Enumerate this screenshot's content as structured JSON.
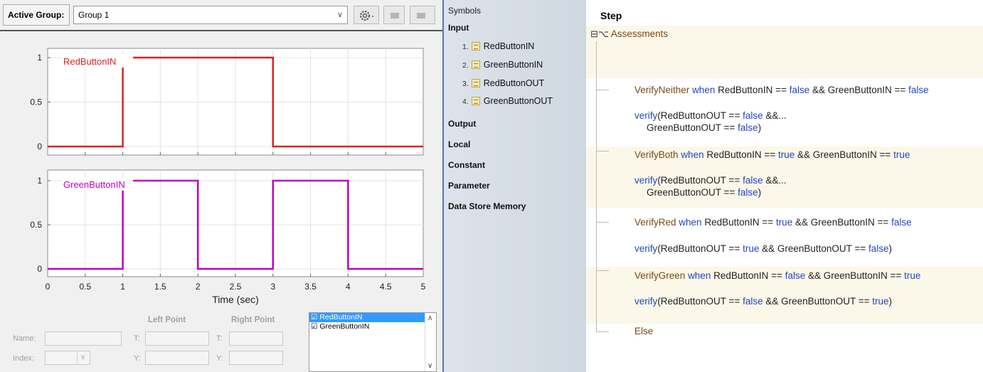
{
  "toolbar": {
    "active_group_label": "Active Group:",
    "active_group_value": "Group 1"
  },
  "chart_data": [
    {
      "type": "line",
      "series": [
        {
          "name": "RedButtonIN",
          "color": "#e02020",
          "x": [
            0,
            1,
            1,
            3,
            3,
            5
          ],
          "y": [
            0,
            0,
            1,
            1,
            0,
            0
          ]
        }
      ],
      "ylim": [
        0,
        1
      ],
      "yticks": [
        "0",
        "0.5",
        "1"
      ],
      "xlim": [
        0,
        5
      ]
    },
    {
      "type": "line",
      "series": [
        {
          "name": "GreenButtonIN",
          "color": "#c000c0",
          "x": [
            0,
            1,
            1,
            2,
            2,
            3,
            3,
            4,
            4,
            5
          ],
          "y": [
            0,
            0,
            1,
            1,
            0,
            0,
            1,
            1,
            0,
            0
          ]
        }
      ],
      "ylim": [
        0,
        1
      ],
      "yticks": [
        "0",
        "0.5",
        "1"
      ],
      "xticks": [
        "0",
        "0.5",
        "1",
        "1.5",
        "2",
        "2.5",
        "3",
        "3.5",
        "4",
        "4.5",
        "5"
      ],
      "xlabel": "Time (sec)",
      "xlim": [
        0,
        5
      ]
    }
  ],
  "details": {
    "left_point": "Left Point",
    "right_point": "Right Point",
    "name_label": "Name:",
    "index_label": "Index:",
    "t_label": "T:",
    "y_label": "Y:"
  },
  "signal_list": [
    {
      "label": "☑ RedButtonIN",
      "selected": true
    },
    {
      "label": "☑ GreenButtonIN",
      "selected": false
    }
  ],
  "symbols": {
    "title": "Symbols",
    "sections": {
      "input": "Input",
      "output": "Output",
      "local": "Local",
      "constant": "Constant",
      "parameter": "Parameter",
      "dsm": "Data Store Memory"
    },
    "inputs": [
      {
        "num": "1.",
        "name": "RedButtonIN"
      },
      {
        "num": "2.",
        "name": "GreenButtonIN"
      },
      {
        "num": "3.",
        "name": "RedButtonOUT"
      },
      {
        "num": "4.",
        "name": "GreenButtonOUT"
      }
    ]
  },
  "steps": {
    "header": "Step",
    "root_icon": "⊟⌥",
    "root": "Assessments",
    "items": [
      {
        "name": "VerifyNeither",
        "when": "when",
        "cond_a": "RedButtonIN ==",
        "val_a": "false",
        "and": "&& GreenButtonIN ==",
        "val_b": "false",
        "verify_kw": "verify",
        "line1_a": "(RedButtonOUT ==",
        "line1_v": "false",
        "line1_b": "&&...",
        "line2_a": "GreenButtonOUT ==",
        "line2_v": "false",
        "line2_b": ")"
      },
      {
        "name": "VerifyBoth",
        "when": "when",
        "cond_a": "RedButtonIN ==",
        "val_a": "true",
        "and": "&& GreenButtonIN ==",
        "val_b": "true",
        "verify_kw": "verify",
        "line1_a": "(RedButtonOUT ==",
        "line1_v": "false",
        "line1_b": "&&...",
        "line2_a": "GreenButtonOUT ==",
        "line2_v": "false",
        "line2_b": ")"
      },
      {
        "name": "VerifyRed",
        "when": "when",
        "cond_a": "RedButtonIN ==",
        "val_a": "true",
        "and": "&& GreenButtonIN ==",
        "val_b": "false",
        "verify_kw": "verify",
        "line1_a": "(RedButtonOUT ==",
        "line1_v": "true",
        "line1_b": "&& GreenButtonOUT ==",
        "line1_v2": "false",
        "line1_c": ")"
      },
      {
        "name": "VerifyGreen",
        "when": "when",
        "cond_a": "RedButtonIN ==",
        "val_a": "false",
        "and": "&& GreenButtonIN ==",
        "val_b": "true",
        "verify_kw": "verify",
        "line1_a": "(RedButtonOUT ==",
        "line1_v": "false",
        "line1_b": "&& GreenButtonOUT ==",
        "line1_v2": "true",
        "line1_c": ")"
      }
    ],
    "else": "Else"
  },
  "colors": {
    "red_signal": "#e02020",
    "green_signal": "#c000c0",
    "keyword": "#2346c0",
    "step_name": "#7a4a16",
    "band": "#fbf8e9"
  }
}
